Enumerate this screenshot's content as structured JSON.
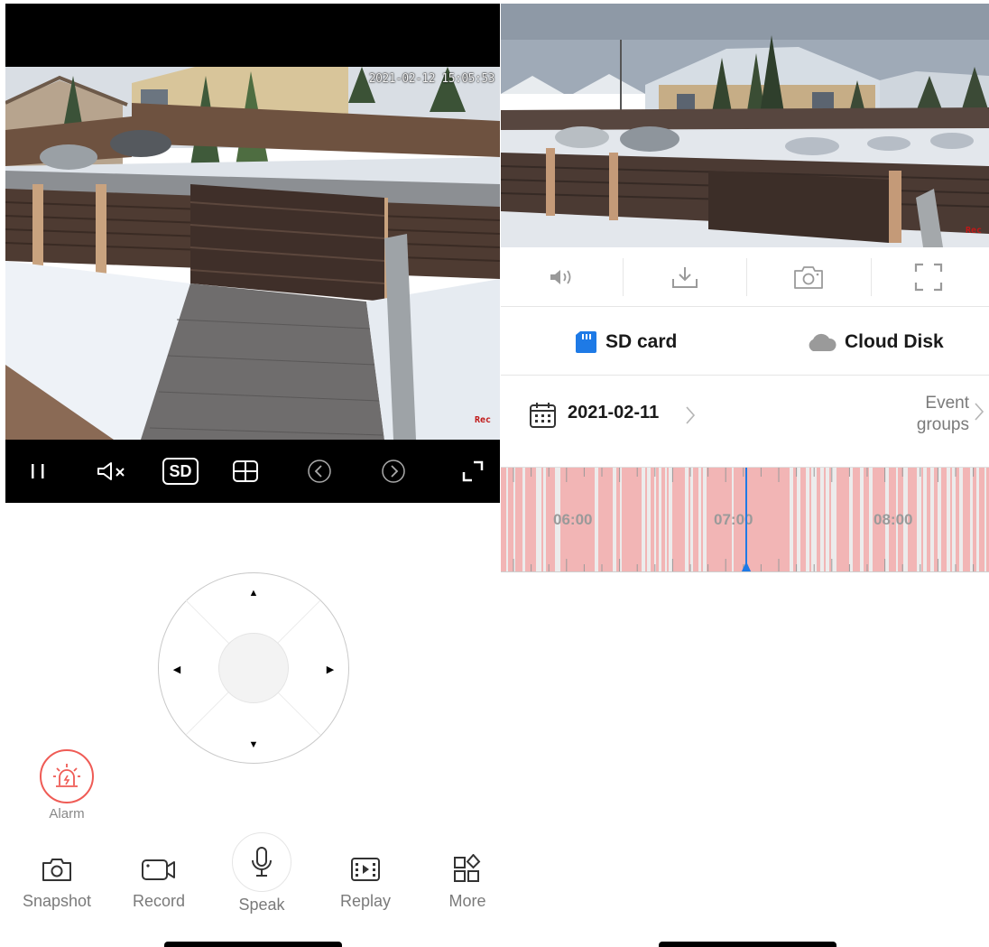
{
  "left": {
    "osd_timestamp": "2021-02-12 15:05:53",
    "osd_rec": "Rec",
    "controls": [
      {
        "name": "pause",
        "icon": "pause-icon"
      },
      {
        "name": "mute",
        "icon": "speaker-muted-icon"
      },
      {
        "name": "quality",
        "label": "SD"
      },
      {
        "name": "multiview",
        "icon": "grid-icon"
      },
      {
        "name": "previous",
        "icon": "chevron-left-circle-icon"
      },
      {
        "name": "next",
        "icon": "chevron-right-circle-icon"
      },
      {
        "name": "fullscreen",
        "icon": "expand-icon"
      }
    ],
    "ptz": {
      "up": "▲",
      "down": "▼",
      "left": "◀",
      "right": "▶"
    },
    "alarm_label": "Alarm",
    "toolbar": {
      "snapshot": "Snapshot",
      "record": "Record",
      "speak": "Speak",
      "replay": "Replay",
      "more": "More"
    }
  },
  "right": {
    "osd_rec": "Rec",
    "actions": [
      "volume-icon",
      "download-icon",
      "camera-icon",
      "fullscreen-icon"
    ],
    "storage": {
      "sd_card": "SD card",
      "cloud_disk": "Cloud Disk"
    },
    "date": "2021-02-11",
    "event_groups": "Event groups",
    "timeline": {
      "labels": [
        "06:00",
        "07:00",
        "08:00"
      ],
      "cursor_time": "07:00"
    }
  },
  "colors": {
    "alarm": "#ef5b55",
    "accent_blue": "#1e7ae6",
    "timeline_event": "#f2b5b5",
    "timeline_empty": "#ececec"
  }
}
